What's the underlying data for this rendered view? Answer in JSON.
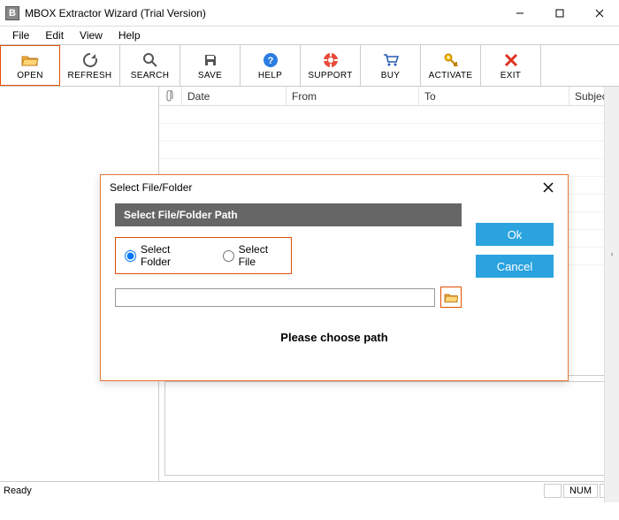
{
  "window": {
    "title": "MBOX Extractor Wizard (Trial Version)",
    "app_icon_letter": "B"
  },
  "menu": {
    "file": "File",
    "edit": "Edit",
    "view": "View",
    "help": "Help"
  },
  "toolbar": {
    "open": "OPEN",
    "refresh": "REFRESH",
    "search": "SEARCH",
    "save": "SAVE",
    "help": "HELP",
    "support": "SUPPORT",
    "buy": "BUY",
    "activate": "ACTIVATE",
    "exit": "EXIT"
  },
  "columns": {
    "date": "Date",
    "from": "From",
    "to": "To",
    "subject": "Subject"
  },
  "status": {
    "ready": "Ready",
    "num": "NUM"
  },
  "dialog": {
    "title": "Select File/Folder",
    "section": "Select File/Folder Path",
    "opt_folder": "Select Folder",
    "opt_file": "Select File",
    "path_value": "",
    "ok": "Ok",
    "cancel": "Cancel",
    "message": "Please choose path"
  },
  "colors": {
    "accent": "#e67838",
    "button": "#2aa3de"
  }
}
